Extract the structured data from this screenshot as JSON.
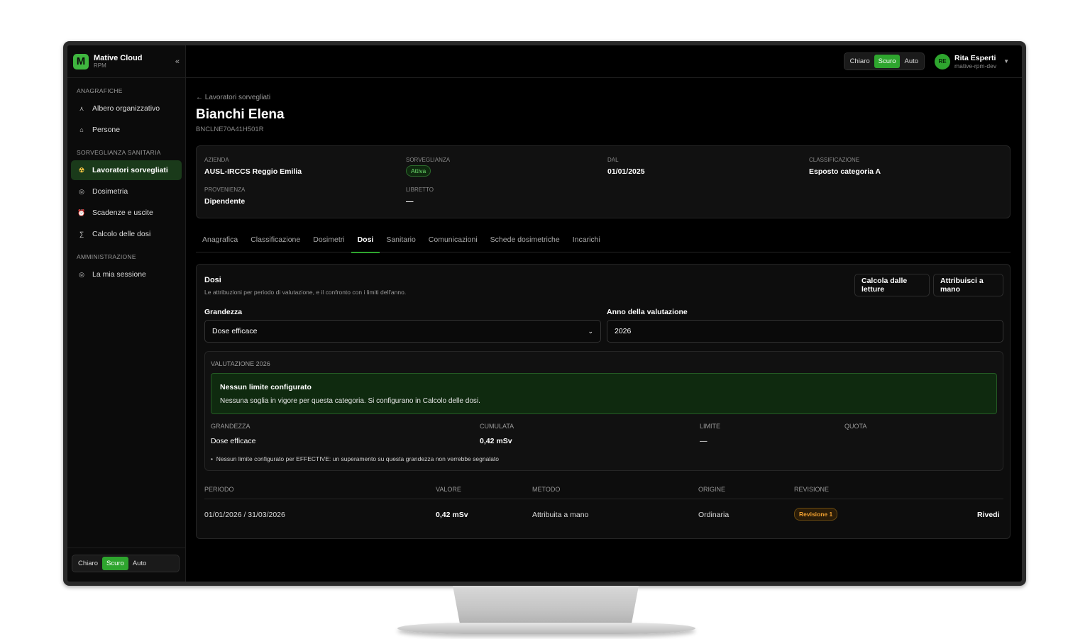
{
  "brand": {
    "name": "Mative Cloud",
    "sub": "RPM",
    "collapse": "«"
  },
  "sidebar": {
    "sections": [
      {
        "label": "ANAGRAFICHE",
        "items": [
          {
            "label": "Albero organizzativo",
            "icon": "org-tree-icon"
          },
          {
            "label": "Persone",
            "icon": "person-icon"
          }
        ]
      },
      {
        "label": "SORVEGLIANZA SANITARIA",
        "items": [
          {
            "label": "Lavoratori sorvegliati",
            "icon": "radiation-icon",
            "active": true
          },
          {
            "label": "Dosimetria",
            "icon": "dosimeter-icon"
          },
          {
            "label": "Scadenze e uscite",
            "icon": "alarm-icon"
          },
          {
            "label": "Calcolo delle dosi",
            "icon": "sigma-icon"
          }
        ]
      },
      {
        "label": "AMMINISTRAZIONE",
        "items": [
          {
            "label": "La mia sessione",
            "icon": "session-icon"
          }
        ]
      }
    ]
  },
  "theme": {
    "light": "Chiaro",
    "dark": "Scuro",
    "auto": "Auto",
    "selected": "Scuro"
  },
  "user": {
    "initials": "RE",
    "name": "Rita Esperti",
    "sub": "mative-rpm-dev"
  },
  "page": {
    "back": "← Lavoratori sorvegliati",
    "title": "Bianchi Elena",
    "code": "BNCLNE70A41H501R"
  },
  "summary": {
    "azienda_label": "AZIENDA",
    "azienda": "AUSL-IRCCS Reggio Emilia",
    "sorveglianza_label": "SORVEGLIANZA",
    "sorveglianza": "Attiva",
    "dal_label": "DAL",
    "dal": "01/01/2025",
    "classificazione_label": "CLASSIFICAZIONE",
    "classificazione": "Esposto categoria A",
    "provenienza_label": "PROVENIENZA",
    "provenienza": "Dipendente",
    "libretto_label": "LIBRETTO",
    "libretto": "—"
  },
  "tabs": [
    "Anagrafica",
    "Classificazione",
    "Dosimetri",
    "Dosi",
    "Sanitario",
    "Comunicazioni",
    "Schede dosimetriche",
    "Incarichi"
  ],
  "active_tab": "Dosi",
  "dosi": {
    "title": "Dosi",
    "description": "Le attribuzioni per periodo di valutazione, e il confronto con i limiti dell'anno.",
    "btn_calc": "Calcola dalle letture",
    "btn_manual": "Attribuisci a mano",
    "grandezza_label": "Grandezza",
    "grandezza_value": "Dose efficace",
    "anno_label": "Anno della valutazione",
    "anno_value": "2026"
  },
  "valutazione": {
    "title": "VALUTAZIONE 2026",
    "alert_title": "Nessun limite configurato",
    "alert_text": "Nessuna soglia in vigore per questa categoria. Si configurano in Calcolo delle dosi.",
    "headers": [
      "GRANDEZZA",
      "CUMULATA",
      "LIMITE",
      "QUOTA"
    ],
    "row": {
      "grandezza": "Dose efficace",
      "cumulata": "0,42 mSv",
      "limite": "—",
      "quota": ""
    },
    "note": "Nessun limite configurato per EFFECTIVE: un superamento su questa grandezza non verrebbe segnalato"
  },
  "table": {
    "headers": [
      "PERIODO",
      "VALORE",
      "METODO",
      "ORIGINE",
      "REVISIONE"
    ],
    "rows": [
      {
        "periodo": "01/01/2026 / 31/03/2026",
        "valore": "0,42 mSv",
        "metodo": "Attribuita a mano",
        "origine": "Ordinaria",
        "revisione": "Revisione 1",
        "action": "Rivedi"
      }
    ]
  }
}
